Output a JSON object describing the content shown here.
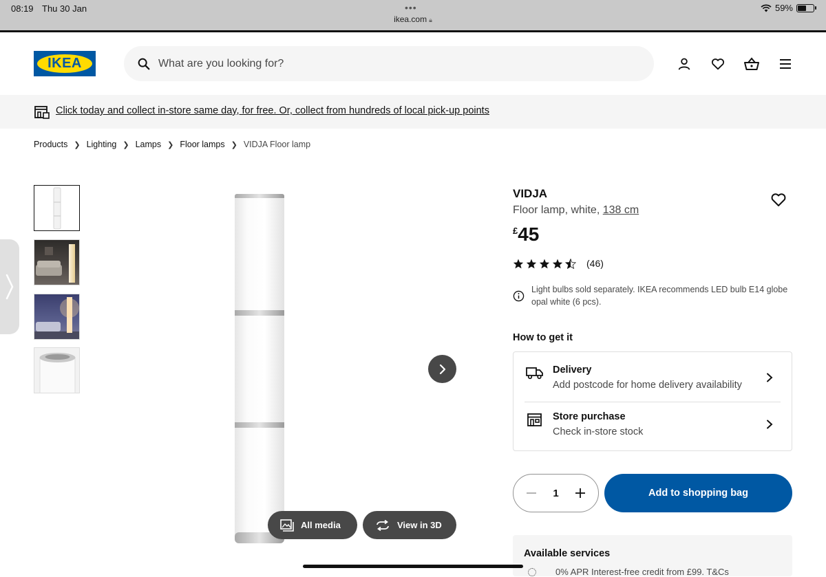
{
  "status_bar": {
    "time": "08:19",
    "date": "Thu 30 Jan",
    "url": "ikea.com",
    "battery": "59%"
  },
  "header": {
    "logo_text": "IKEA",
    "search_placeholder": "What are you looking for?",
    "icons": [
      "user-icon",
      "heart-icon",
      "basket-icon",
      "menu-icon"
    ]
  },
  "banner": {
    "text": "Click today and collect in-store same day, for free. Or, collect from hundreds of local pick-up points"
  },
  "breadcrumbs": [
    "Products",
    "Lighting",
    "Lamps",
    "Floor lamps",
    "VIDJA Floor lamp"
  ],
  "gallery": {
    "buttons": {
      "all_media": "All media",
      "view_3d": "View in 3D"
    }
  },
  "product": {
    "name": "VIDJA",
    "description": "Floor lamp, white,",
    "size": "138 cm",
    "currency": "£",
    "price": "45",
    "rating": 4.5,
    "reviews": "(46)",
    "info": "Light bulbs sold separately. IKEA recommends LED bulb E14 globe opal white (6 pcs)."
  },
  "get_it": {
    "heading": "How to get it",
    "delivery": {
      "title": "Delivery",
      "subtitle": "Add postcode for home delivery availability"
    },
    "store": {
      "title": "Store purchase",
      "subtitle": "Check in-store stock"
    }
  },
  "purchase": {
    "quantity": "1",
    "add_to_bag": "Add to shopping bag"
  },
  "services": {
    "title": "Available services",
    "line": "0% APR Interest-free credit from £99. T&Cs"
  },
  "colors": {
    "ikea_blue": "#0058a3",
    "ikea_yellow": "#ffdb00"
  }
}
